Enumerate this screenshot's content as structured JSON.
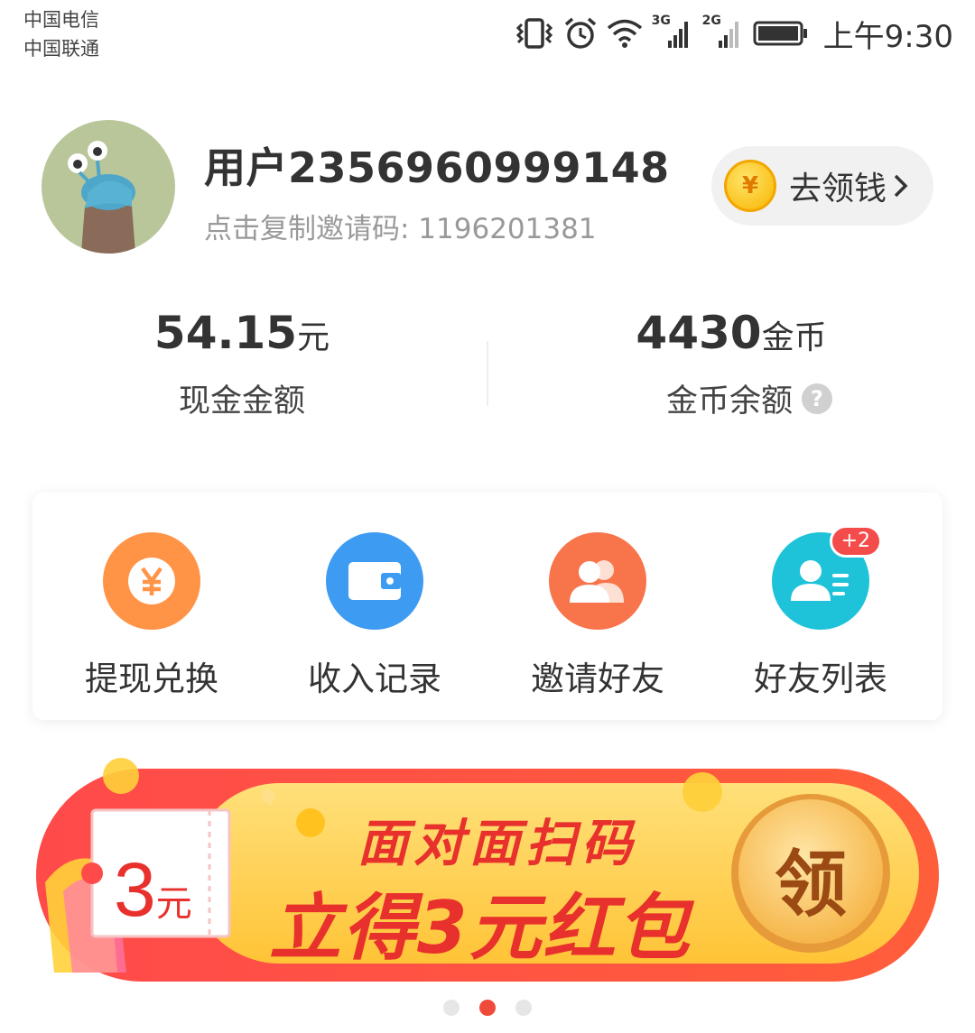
{
  "status_bar": {
    "carrier1": "中国电信",
    "carrier2": "中国联通",
    "net1": "3G",
    "net2": "2G",
    "time": "上午9:30"
  },
  "profile": {
    "username": "用户2356960999148",
    "invite_text": "点击复制邀请码: 1196201381",
    "claim_label": "去领钱",
    "claim_coin_symbol": "¥"
  },
  "stats": {
    "cash_value": "54.15",
    "cash_unit": "元",
    "cash_label": "现金金额",
    "coin_value": "4430",
    "coin_unit": "金币",
    "coin_label": "金币余额",
    "help_symbol": "?"
  },
  "shortcuts": [
    {
      "label": "提现兑换",
      "icon": "yen-coin-icon",
      "color": "#ff9346"
    },
    {
      "label": "收入记录",
      "icon": "wallet-icon",
      "color": "#3d9bf2"
    },
    {
      "label": "邀请好友",
      "icon": "users-icon",
      "color": "#f8744b"
    },
    {
      "label": "好友列表",
      "icon": "contact-list-icon",
      "color": "#1fc3d9",
      "badge": "+2"
    }
  ],
  "banner": {
    "ticket_amount": "3",
    "ticket_unit": "元",
    "headline": "面对面扫码",
    "subline": "立得3元红包",
    "button": "领"
  },
  "carousel": {
    "count": 3,
    "active_index": 1
  },
  "colors": {
    "accent_red": "#f04b3a",
    "banner_yellow": "#ffd24d"
  }
}
